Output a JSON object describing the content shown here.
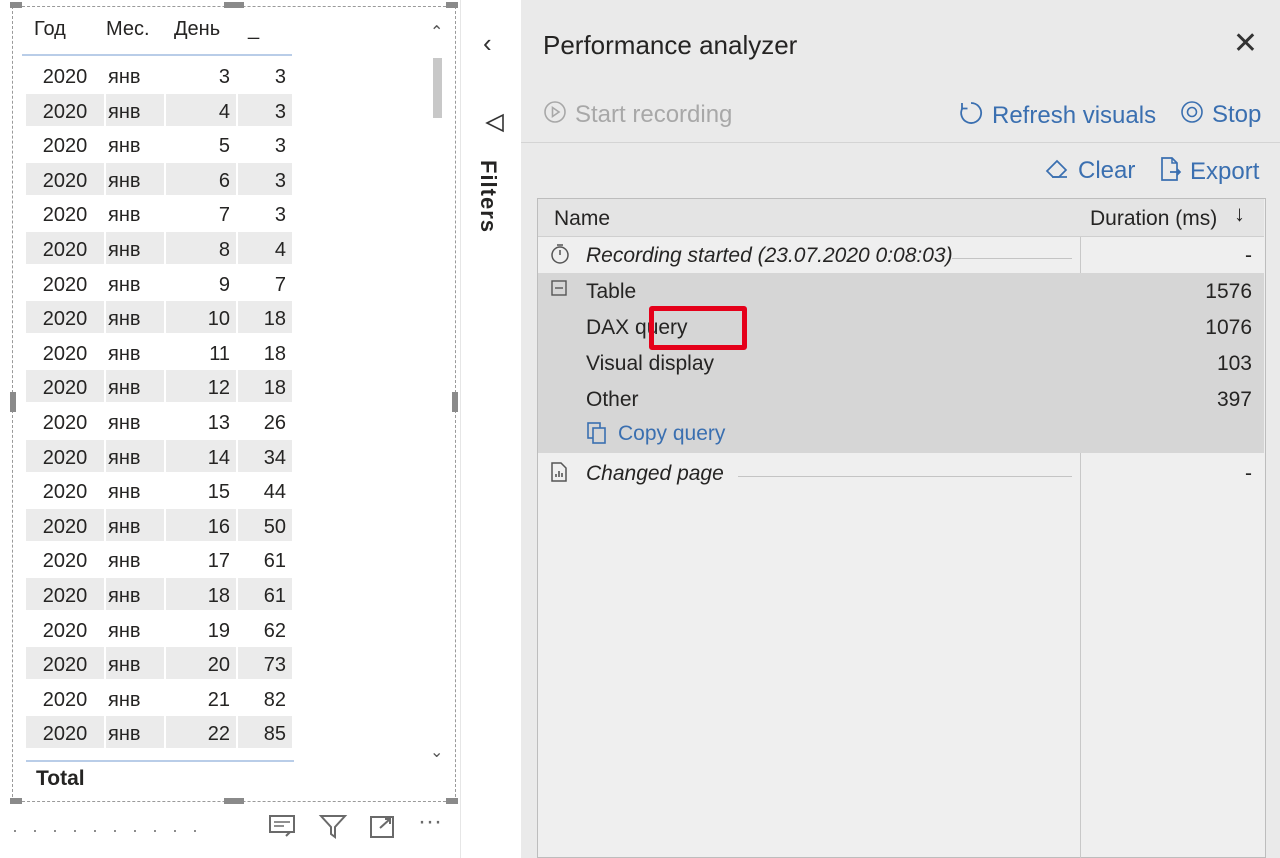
{
  "table_visual": {
    "columns": [
      "Год",
      "Мес.",
      "День",
      "_"
    ],
    "rows": [
      {
        "year": "2020",
        "month": "янв",
        "day": "3",
        "value": "3"
      },
      {
        "year": "2020",
        "month": "янв",
        "day": "4",
        "value": "3"
      },
      {
        "year": "2020",
        "month": "янв",
        "day": "5",
        "value": "3"
      },
      {
        "year": "2020",
        "month": "янв",
        "day": "6",
        "value": "3"
      },
      {
        "year": "2020",
        "month": "янв",
        "day": "7",
        "value": "3"
      },
      {
        "year": "2020",
        "month": "янв",
        "day": "8",
        "value": "4"
      },
      {
        "year": "2020",
        "month": "янв",
        "day": "9",
        "value": "7"
      },
      {
        "year": "2020",
        "month": "янв",
        "day": "10",
        "value": "18"
      },
      {
        "year": "2020",
        "month": "янв",
        "day": "11",
        "value": "18"
      },
      {
        "year": "2020",
        "month": "янв",
        "day": "12",
        "value": "18"
      },
      {
        "year": "2020",
        "month": "янв",
        "day": "13",
        "value": "26"
      },
      {
        "year": "2020",
        "month": "янв",
        "day": "14",
        "value": "34"
      },
      {
        "year": "2020",
        "month": "янв",
        "day": "15",
        "value": "44"
      },
      {
        "year": "2020",
        "month": "янв",
        "day": "16",
        "value": "50"
      },
      {
        "year": "2020",
        "month": "янв",
        "day": "17",
        "value": "61"
      },
      {
        "year": "2020",
        "month": "янв",
        "day": "18",
        "value": "61"
      },
      {
        "year": "2020",
        "month": "янв",
        "day": "19",
        "value": "62"
      },
      {
        "year": "2020",
        "month": "янв",
        "day": "20",
        "value": "73"
      },
      {
        "year": "2020",
        "month": "янв",
        "day": "21",
        "value": "82"
      },
      {
        "year": "2020",
        "month": "янв",
        "day": "22",
        "value": "85"
      }
    ],
    "total_label": "Total",
    "visual_icons": [
      "comment-icon",
      "filter-icon",
      "focus-mode-icon",
      "more-options-icon"
    ]
  },
  "filters_pane": {
    "label": "Filters"
  },
  "performance_analyzer": {
    "title": "Performance analyzer",
    "start_recording": "Start recording",
    "refresh_visuals": "Refresh visuals",
    "stop": "Stop",
    "clear": "Clear",
    "export": "Export",
    "columns": {
      "name": "Name",
      "duration": "Duration (ms)"
    },
    "entries": {
      "recording": {
        "name": "Recording started (23.07.2020 0:08:03)",
        "duration": "-"
      },
      "table": {
        "name": "Table",
        "duration": "1576"
      },
      "dax": {
        "name": "DAX query",
        "duration": "1076"
      },
      "visual_display": {
        "name": "Visual display",
        "duration": "103"
      },
      "other": {
        "name": "Other",
        "duration": "397"
      },
      "copy_query": "Copy query",
      "changed_page": {
        "name": "Changed page",
        "duration": "-"
      }
    },
    "highlight_color": "#e5001a",
    "accent_color": "#3a6fb0"
  }
}
